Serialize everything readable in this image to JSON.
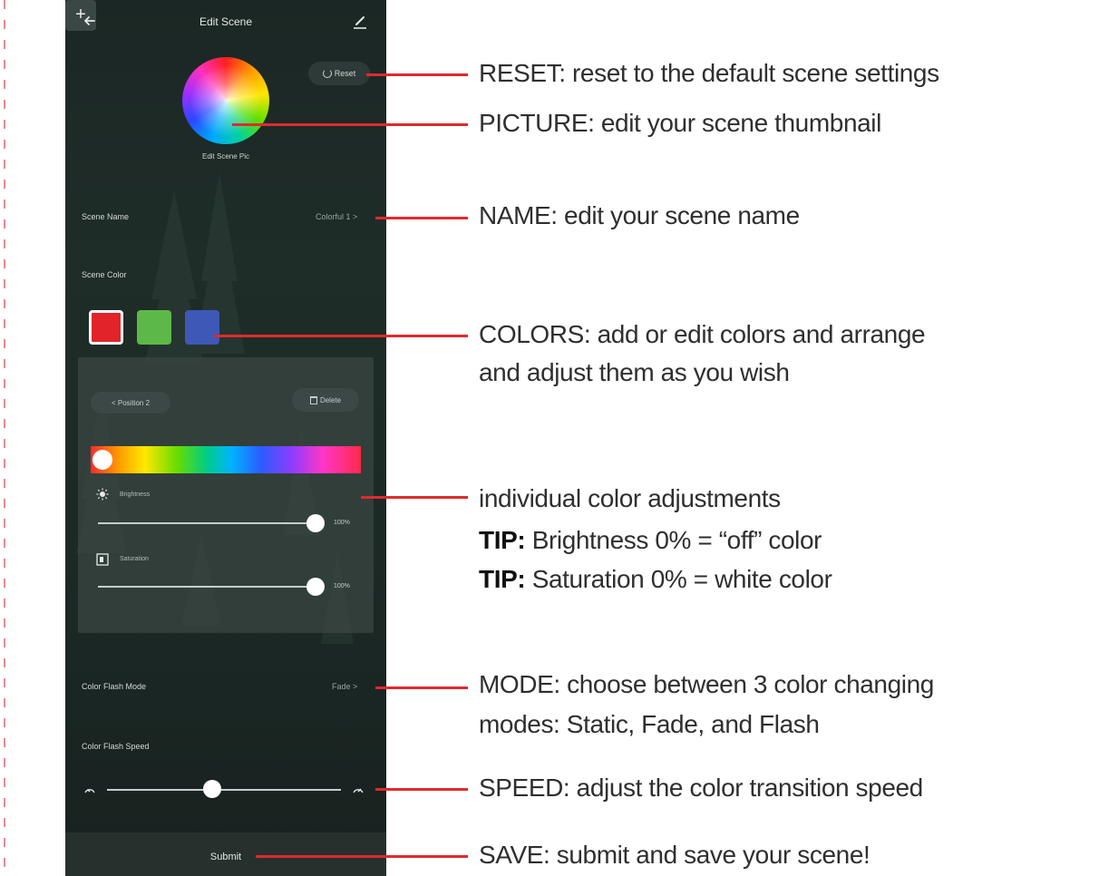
{
  "phone": {
    "title": "Edit Scene",
    "reset_label": "Reset",
    "scene_pic_label": "Edit Scene Pic",
    "scene_name_label": "Scene Name",
    "scene_name_value": "Colorful 1 >",
    "scene_color_label": "Scene Color",
    "colors": [
      "#e2232a",
      "#5cb947",
      "#3e58b8"
    ],
    "add_label": "+",
    "position_label": "< Position 2",
    "delete_label": "Delete",
    "brightness_label": "Brightness",
    "brightness_value": "100%",
    "saturation_label": "Saturation",
    "saturation_value": "100%",
    "flash_mode_label": "Color Flash Mode",
    "flash_mode_value": "Fade >",
    "flash_speed_label": "Color Flash Speed",
    "speed_level": 0.45,
    "submit_label": "Submit"
  },
  "annotations": {
    "reset": "RESET: reset to the default scene settings",
    "picture": "PICTURE: edit your scene thumbnail",
    "name": "NAME: edit your scene name",
    "colors_line1": "COLORS: add or edit colors and arrange",
    "colors_line2": "and adjust them as you wish",
    "adjust": "individual color adjustments",
    "tip_label": "TIP:",
    "tip1": "Brightness 0% = “off” color",
    "tip2": "Saturation 0% = white color",
    "mode_line1": "MODE: choose between 3 color changing",
    "mode_line2": "modes: Static, Fade, and Flash",
    "speed": "SPEED: adjust the color transition speed",
    "save": "SAVE: submit and save your scene!"
  },
  "accent_color": "#e02a30"
}
